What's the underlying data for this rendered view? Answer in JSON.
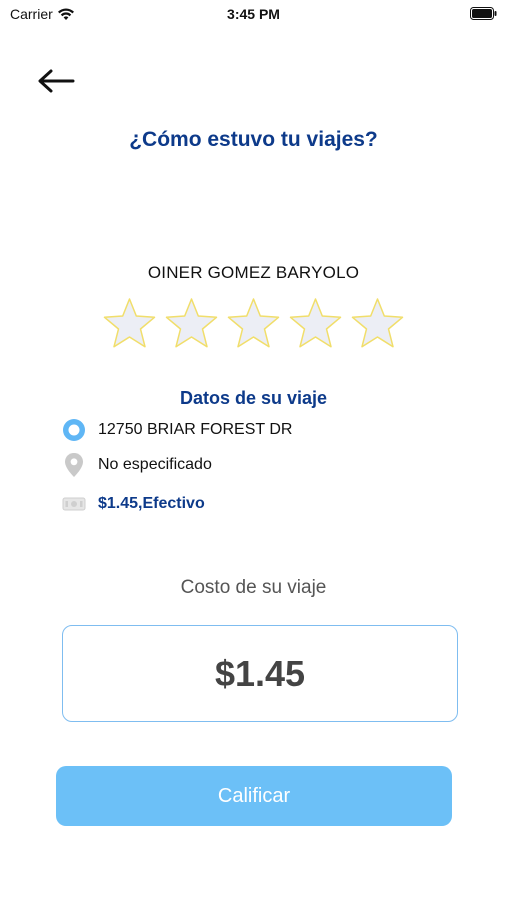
{
  "status_bar": {
    "carrier": "Carrier",
    "time": "3:45 PM"
  },
  "header": {
    "back_icon": "arrow-left-icon",
    "title": "¿Cómo estuvo tu viajes?"
  },
  "driver": {
    "name": "OINER GOMEZ BARYOLO"
  },
  "rating": {
    "max_stars": 5,
    "selected": 0
  },
  "trip": {
    "section_title": "Datos de su viaje",
    "origin": "12750 BRIAR FOREST DR",
    "destination": "No especificado",
    "payment": "$1.45,Efectivo"
  },
  "cost": {
    "label": "Costo de su viaje",
    "value": "$1.45"
  },
  "action": {
    "rate_label": "Calificar"
  },
  "colors": {
    "title_blue": "#0d3a8a",
    "button_blue": "#6cc0f7",
    "border_blue": "#7fbdf0",
    "star_fill": "#eceef5",
    "star_stroke": "#f1de6a"
  }
}
